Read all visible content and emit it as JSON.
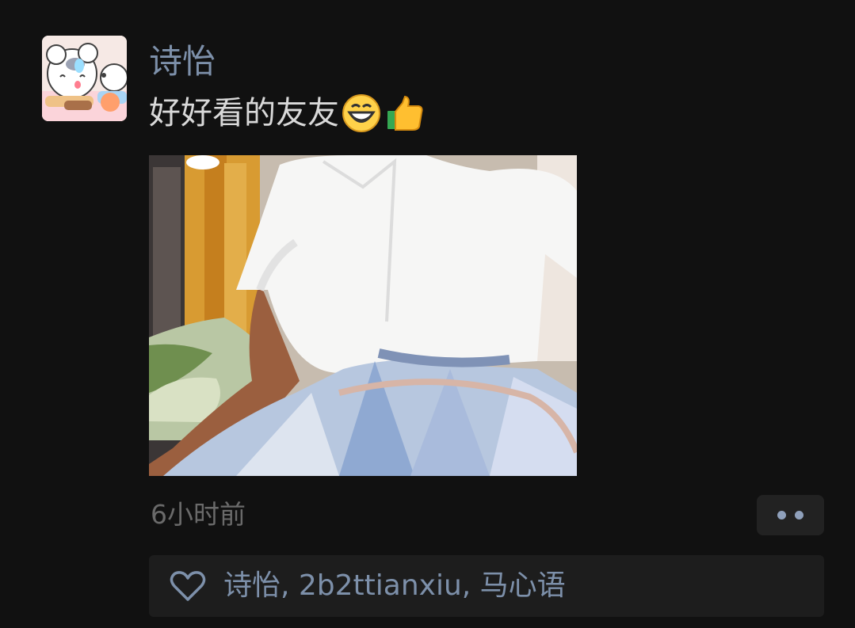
{
  "post": {
    "username": "诗怡",
    "text": "好好看的友友",
    "emoji": [
      "grinning-face-emoji",
      "thumbs-up-emoji"
    ],
    "time": "6小时前",
    "likes": "诗怡, 2b2ttianxiu, 马心语"
  },
  "icons": {
    "avatar": "cartoon-cat-avatar",
    "more": "more-dots-icon",
    "like": "heart-icon"
  },
  "colors": {
    "background": "#111111",
    "name": "#7d90aa",
    "text": "#d9d9d9",
    "time": "#6a6a6a",
    "panel": "#1d1d1d",
    "button": "#222222",
    "accent": "#8fa0bb"
  }
}
